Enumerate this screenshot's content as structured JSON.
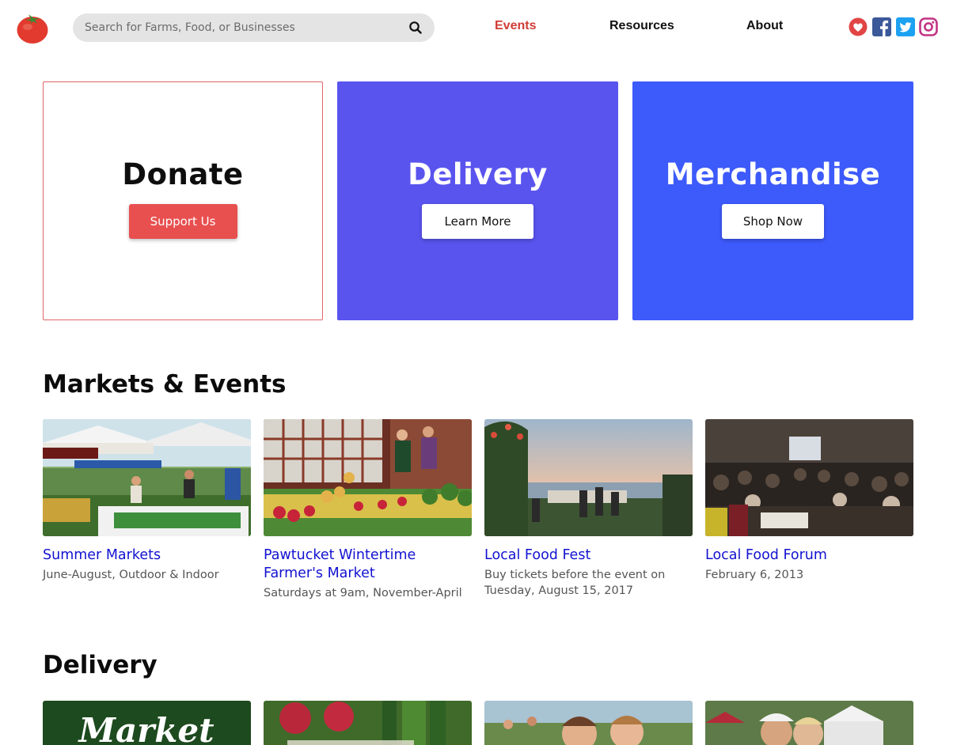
{
  "header": {
    "search": {
      "placeholder": "Search for Farms, Food, or Businesses",
      "value": ""
    },
    "nav": [
      {
        "label": "Events",
        "active": true
      },
      {
        "label": "Resources",
        "active": false
      },
      {
        "label": "About",
        "active": false
      }
    ],
    "social_icons": [
      "heart-icon",
      "facebook-icon",
      "twitter-icon",
      "instagram-icon"
    ]
  },
  "tiles": [
    {
      "title": "Donate",
      "button": "Support Us"
    },
    {
      "title": "Delivery",
      "button": "Learn More"
    },
    {
      "title": "Merchandise",
      "button": "Shop Now"
    }
  ],
  "markets": {
    "title": "Markets & Events",
    "cards": [
      {
        "title": "Summer Markets",
        "subtitle": "June-August, Outdoor & Indoor"
      },
      {
        "title": "Pawtucket Wintertime Farmer's Market",
        "subtitle": "Saturdays at 9am, November-April"
      },
      {
        "title": "Local Food Fest",
        "subtitle": "Buy tickets before the event on Tuesday, August 15, 2017"
      },
      {
        "title": "Local Food Forum",
        "subtitle": "February 6, 2013"
      }
    ]
  },
  "delivery": {
    "title": "Delivery",
    "card_texts": [
      "Market"
    ]
  },
  "colors": {
    "accent_red": "#d13b35",
    "button_red": "#e84f4f",
    "delivery_tile": "#5a54ef",
    "merch_tile": "#3d5afb",
    "link_blue": "#1212d1"
  }
}
